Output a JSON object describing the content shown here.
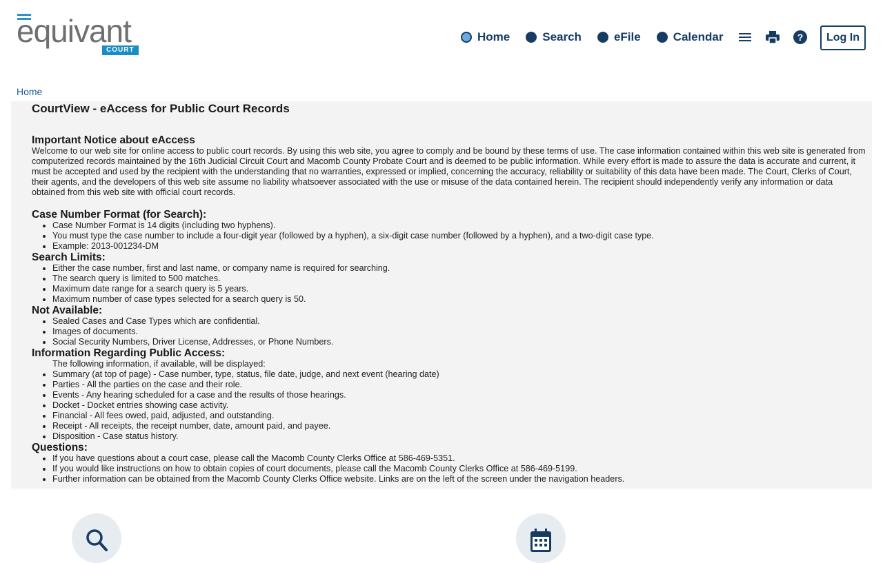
{
  "brand": {
    "word": "equivant",
    "court": "COURT"
  },
  "nav": {
    "items": [
      "Home",
      "Search",
      "eFile",
      "Calendar"
    ],
    "menu_icon": "hamburger-icon",
    "print_icon": "printer-icon",
    "help_icon": "help-circle-icon",
    "login": "Log In"
  },
  "colors": {
    "primary": "#163c63",
    "accent": "#1a8dc6",
    "panel": "#f3f3f3"
  },
  "breadcrumb": "Home",
  "page": {
    "title": "CourtView - eAccess for Public Court Records",
    "notice_title": "Important Notice about eAccess",
    "notice_text": "Welcome to our web site for online access to public court records.  By using this web site, you agree to comply and be bound by these terms of use.  The case information contained within this web site is generated from computerized records maintained by the 16th Judicial Circuit Court and Macomb County Probate Court and is deemed to be public information. While every effort is made to assure the data is accurate and current, it must be accepted and used by the recipient with the understanding that no warranties, expressed or implied, concerning the accuracy, reliability or suitability of this data have been made. The Court, Clerks of Court, their agents, and the developers of this web site assume no liability whatsoever associated with the use or misuse of the data contained herein.  The recipient should independently verify any information or data obtained from this web site with official court records.",
    "format_title": "Case Number Format (for Search):",
    "format_items": [
      "Case Number Format is 14 digits (including two hyphens).",
      "You must type the case number to include a four-digit year (followed by a hyphen), a six-digit case number (followed by a hyphen), and a two-digit case type.",
      "Example: 2013-001234-DM"
    ],
    "limits_title": "Search Limits:",
    "limits_items": [
      "Either the case number, first and last name, or company name is required for searching.",
      "The search query is limited to 500 matches.",
      "Maximum date range for a search query is 5 years.",
      "Maximum number of case types selected for a search query is 50."
    ],
    "na_title": "Not Available:",
    "na_items": [
      "Sealed Cases and Case Types which are confidential.",
      "Images of documents.",
      "Social Security Numbers, Driver License, Addresses, or Phone Numbers."
    ],
    "access_title": "Information Regarding Public Access:",
    "access_intro": "The following information, if available, will be displayed:",
    "access_items": [
      "Summary (at top of page) - Case number, type, status, file date, judge, and next event (hearing date)",
      "Parties - All the parties on the case and their role.",
      "Events - Any hearing scheduled for a case and the results of those hearings.",
      "Docket - Docket entries showing case activity.",
      "Financial - All fees owed, paid, adjusted, and outstanding.",
      "Receipt - All receipts, the receipt number, date, amount paid, and payee.",
      "Disposition - Case status history."
    ],
    "questions_title": "Questions:",
    "questions_items": [
      "If you have questions about a court case, please call the Macomb County Clerks Office at 586-469-5351.",
      "If you would like instructions on how to obtain copies of court documents, please call the Macomb County Clerks Office at 586-469-5199.",
      "Further information can be obtained from the Macomb County Clerks Office website.  Links are on the left of the screen under the navigation headers."
    ]
  },
  "tiles": {
    "search_icon": "search-icon",
    "calendar_icon": "calendar-icon"
  }
}
